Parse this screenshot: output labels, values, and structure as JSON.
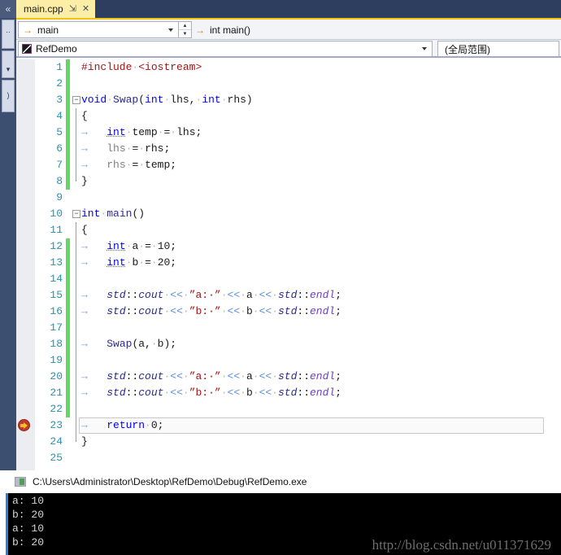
{
  "left_rail": {
    "collapse_icon": "«",
    "tabs": [
      {
        "name": "tool-window-tab-1",
        "label": "··"
      },
      {
        "name": "tool-window-tab-2",
        "label": "▾"
      },
      {
        "name": "tool-window-tab-3",
        "label": ")"
      }
    ]
  },
  "tabstrip": {
    "active_tab": "main.cpp",
    "pin_icon": "⇲",
    "close_icon": "✕"
  },
  "navbar": {
    "member_arrow_icon": "→",
    "member_value": "main",
    "signature_arrow_icon": "→",
    "signature_value": "int main()",
    "spinner_up": "▲",
    "spinner_down": "▼"
  },
  "scopebar": {
    "project_value": "RefDemo",
    "global_scope_value": "(全局范围)"
  },
  "editor": {
    "fold_glyph": "−",
    "breakpoint_line": 23,
    "lines": [
      {
        "n": 1,
        "changed": true,
        "fold": false,
        "guide": "none",
        "html": "<span class=\"inc\">#include</span><span class=\"ws\">·</span><span class=\"inc\">&lt;iostream&gt;</span>"
      },
      {
        "n": 2,
        "changed": true,
        "fold": false,
        "guide": "none",
        "html": ""
      },
      {
        "n": 3,
        "changed": true,
        "fold": true,
        "guide": "none",
        "html": "<span class=\"kw\">void</span><span class=\"ws\">·</span><span class=\"fn\">Swap</span><span class=\"punct\">(</span><span class=\"kw\">int</span><span class=\"ws\">·</span><span class=\"punct\">lhs,</span><span class=\"ws\">·</span><span class=\"kw\">int</span><span class=\"ws\">·</span><span class=\"punct\">rhs)</span>"
      },
      {
        "n": 4,
        "changed": true,
        "fold": false,
        "guide": "full",
        "html": "<span class=\"punct\">{</span>"
      },
      {
        "n": 5,
        "changed": true,
        "fold": false,
        "guide": "full",
        "html": "<span class=\"tabarrow\">→</span>   <span class=\"type-u\">int</span><span class=\"ws\">·</span><span class=\"punct\">temp</span><span class=\"ws\">·</span><span class=\"punct\">=</span><span class=\"ws\">·</span><span class=\"punct\">lhs;</span>"
      },
      {
        "n": 6,
        "changed": true,
        "fold": false,
        "guide": "full",
        "html": "<span class=\"tabarrow\">→</span>   <span class=\"dim\">lhs</span><span class=\"ws\">·</span><span class=\"punct\">=</span><span class=\"ws\">·</span><span class=\"punct\">rhs;</span>"
      },
      {
        "n": 7,
        "changed": true,
        "fold": false,
        "guide": "full",
        "html": "<span class=\"tabarrow\">→</span>   <span class=\"dim\">rhs</span><span class=\"ws\">·</span><span class=\"punct\">=</span><span class=\"ws\">·</span><span class=\"punct\">temp;</span>"
      },
      {
        "n": 8,
        "changed": true,
        "fold": false,
        "guide": "foot",
        "html": "<span class=\"punct\">}</span>"
      },
      {
        "n": 9,
        "changed": false,
        "fold": false,
        "guide": "none",
        "html": ""
      },
      {
        "n": 10,
        "changed": false,
        "fold": true,
        "guide": "none",
        "html": "<span class=\"kw\">int</span><span class=\"ws\">·</span><span class=\"fn\">main</span><span class=\"punct\">()</span>"
      },
      {
        "n": 11,
        "changed": false,
        "fold": false,
        "guide": "full",
        "html": "<span class=\"punct\">{</span>"
      },
      {
        "n": 12,
        "changed": true,
        "fold": false,
        "guide": "full",
        "html": "<span class=\"tabarrow\">→</span>   <span class=\"type-u\">int</span><span class=\"ws\">·</span><span class=\"punct\">a</span><span class=\"ws\">·</span><span class=\"punct\">=</span><span class=\"ws\">·</span><span class=\"num\">10;</span>"
      },
      {
        "n": 13,
        "changed": true,
        "fold": false,
        "guide": "full",
        "html": "<span class=\"tabarrow\">→</span>   <span class=\"type-u\">int</span><span class=\"ws\">·</span><span class=\"punct\">b</span><span class=\"ws\">·</span><span class=\"punct\">=</span><span class=\"ws\">·</span><span class=\"num\">20;</span>"
      },
      {
        "n": 14,
        "changed": true,
        "fold": false,
        "guide": "full",
        "html": ""
      },
      {
        "n": 15,
        "changed": true,
        "fold": false,
        "guide": "full",
        "html": "<span class=\"tabarrow\">→</span>   <span class=\"ns\">std</span><span class=\"punct\">::</span><span class=\"ns\">cout</span><span class=\"ws\">·</span><span class=\"op\">&lt;&lt;</span><span class=\"ws\">·</span><span class=\"str\">”a:·”</span><span class=\"ws\">·</span><span class=\"op\">&lt;&lt;</span><span class=\"ws\">·</span><span class=\"punct\">a</span><span class=\"ws\">·</span><span class=\"op\">&lt;&lt;</span><span class=\"ws\">·</span><span class=\"ns\">std</span><span class=\"punct\">::</span><span class=\"mem\">endl</span><span class=\"punct\">;</span>"
      },
      {
        "n": 16,
        "changed": true,
        "fold": false,
        "guide": "full",
        "html": "<span class=\"tabarrow\">→</span>   <span class=\"ns\">std</span><span class=\"punct\">::</span><span class=\"ns\">cout</span><span class=\"ws\">·</span><span class=\"op\">&lt;&lt;</span><span class=\"ws\">·</span><span class=\"str\">”b:·”</span><span class=\"ws\">·</span><span class=\"op\">&lt;&lt;</span><span class=\"ws\">·</span><span class=\"punct\">b</span><span class=\"ws\">·</span><span class=\"op\">&lt;&lt;</span><span class=\"ws\">·</span><span class=\"ns\">std</span><span class=\"punct\">::</span><span class=\"mem\">endl</span><span class=\"punct\">;</span>"
      },
      {
        "n": 17,
        "changed": true,
        "fold": false,
        "guide": "full",
        "html": ""
      },
      {
        "n": 18,
        "changed": true,
        "fold": false,
        "guide": "full",
        "html": "<span class=\"tabarrow\">→</span>   <span class=\"fn\">Swap</span><span class=\"punct\">(a,</span><span class=\"ws\">·</span><span class=\"punct\">b);</span>"
      },
      {
        "n": 19,
        "changed": true,
        "fold": false,
        "guide": "full",
        "html": ""
      },
      {
        "n": 20,
        "changed": true,
        "fold": false,
        "guide": "full",
        "html": "<span class=\"tabarrow\">→</span>   <span class=\"ns\">std</span><span class=\"punct\">::</span><span class=\"ns\">cout</span><span class=\"ws\">·</span><span class=\"op\">&lt;&lt;</span><span class=\"ws\">·</span><span class=\"str\">”a:·”</span><span class=\"ws\">·</span><span class=\"op\">&lt;&lt;</span><span class=\"ws\">·</span><span class=\"punct\">a</span><span class=\"ws\">·</span><span class=\"op\">&lt;&lt;</span><span class=\"ws\">·</span><span class=\"ns\">std</span><span class=\"punct\">::</span><span class=\"mem\">endl</span><span class=\"punct\">;</span>"
      },
      {
        "n": 21,
        "changed": true,
        "fold": false,
        "guide": "full",
        "html": "<span class=\"tabarrow\">→</span>   <span class=\"ns\">std</span><span class=\"punct\">::</span><span class=\"ns\">cout</span><span class=\"ws\">·</span><span class=\"op\">&lt;&lt;</span><span class=\"ws\">·</span><span class=\"str\">”b:·”</span><span class=\"ws\">·</span><span class=\"op\">&lt;&lt;</span><span class=\"ws\">·</span><span class=\"punct\">b</span><span class=\"ws\">·</span><span class=\"op\">&lt;&lt;</span><span class=\"ws\">·</span><span class=\"ns\">std</span><span class=\"punct\">::</span><span class=\"mem\">endl</span><span class=\"punct\">;</span>"
      },
      {
        "n": 22,
        "changed": true,
        "fold": false,
        "guide": "full",
        "html": ""
      },
      {
        "n": 23,
        "changed": false,
        "fold": false,
        "guide": "full",
        "html": "<span class=\"tabarrow\">→</span>   <span class=\"kw\">return</span><span class=\"ws\">·</span><span class=\"num\">0;</span>"
      },
      {
        "n": 24,
        "changed": false,
        "fold": false,
        "guide": "foot",
        "html": "<span class=\"punct\">}</span>"
      },
      {
        "n": 25,
        "changed": false,
        "fold": false,
        "guide": "none",
        "html": ""
      }
    ]
  },
  "console": {
    "title": "C:\\Users\\Administrator\\Desktop\\RefDemo\\Debug\\RefDemo.exe",
    "output_lines": [
      "a: 10",
      "b: 20",
      "a: 10",
      "b: 20"
    ],
    "watermark": "http://blog.csdn.net/u011371629"
  }
}
